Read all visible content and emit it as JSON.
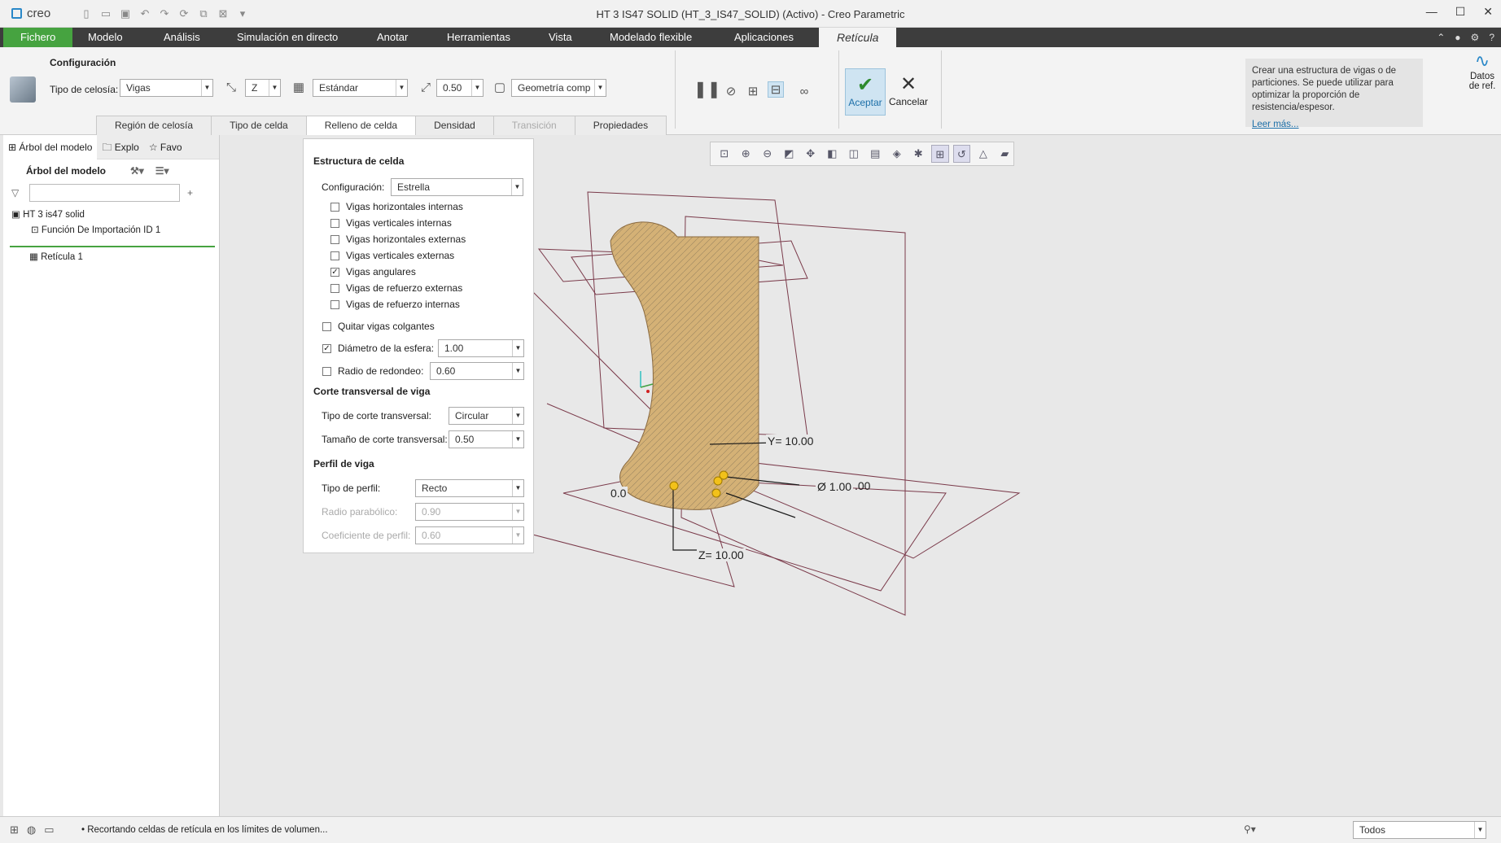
{
  "app": {
    "name": "creo",
    "window_title": "HT 3 IS47 SOLID (HT_3_IS47_SOLID) (Activo) - Creo Parametric"
  },
  "menu": {
    "file": "Fichero",
    "items": [
      "Modelo",
      "Análisis",
      "Simulación en directo",
      "Anotar",
      "Herramientas",
      "Vista",
      "Modelado flexible",
      "Aplicaciones"
    ],
    "active_tab": "Retícula"
  },
  "ribbon": {
    "group_label": "Configuración",
    "lattice_type_label": "Tipo de celosía:",
    "lattice_type_value": "Vigas",
    "axis_value": "Z",
    "pattern_value": "Estándar",
    "size_value": "0.50",
    "geometry_value": "Geometría comp",
    "accept": "Aceptar",
    "cancel": "Cancelar",
    "help_text": "Crear una estructura de vigas o de particiones. Se puede utilizar para optimizar la proporción de resistencia/espesor.",
    "help_link": "Leer más...",
    "ref_data": "Datos de ref."
  },
  "subtabs": [
    "Región de celosía",
    "Tipo de celda",
    "Relleno de celda",
    "Densidad",
    "Transición",
    "Propiedades"
  ],
  "sidebar": {
    "tabs": [
      "Árbol del modelo",
      "Explo",
      "Favo"
    ],
    "tree_title": "Árbol del modelo",
    "nodes": [
      "HT 3 is47 solid",
      "Función De Importación ID 1",
      "Retícula 1"
    ]
  },
  "panel": {
    "section1": "Estructura de celda",
    "config_label": "Configuración:",
    "config_value": "Estrella",
    "checkboxes": [
      {
        "label": "Vigas horizontales internas",
        "checked": false
      },
      {
        "label": "Vigas verticales internas",
        "checked": false
      },
      {
        "label": "Vigas horizontales externas",
        "checked": false
      },
      {
        "label": "Vigas verticales externas",
        "checked": false
      },
      {
        "label": "Vigas angulares",
        "checked": true
      },
      {
        "label": "Vigas de refuerzo externas",
        "checked": false
      },
      {
        "label": "Vigas de refuerzo internas",
        "checked": false
      }
    ],
    "remove_label": "Quitar vigas colgantes",
    "sphere_label": "Diámetro de la esfera:",
    "sphere_value": "1.00",
    "round_label": "Radio de redondeo:",
    "round_value": "0.60",
    "section2": "Corte transversal de viga",
    "cs_type_label": "Tipo de corte transversal:",
    "cs_type_value": "Circular",
    "cs_size_label": "Tamaño de corte transversal:",
    "cs_size_value": "0.50",
    "section3": "Perfil de viga",
    "profile_label": "Tipo de perfil:",
    "profile_value": "Recto",
    "parabolic_label": "Radio parabólico:",
    "parabolic_value": "0.90",
    "coef_label": "Coeficiente de perfil:",
    "coef_value": "0.60"
  },
  "dims": {
    "y": "Y= 10.00",
    "z": "Z= 10.00",
    "x": "0.0",
    "d": "Ø 1.00",
    "d2": ".00"
  },
  "status": {
    "message": "Recortando celdas de retícula en los límites de volumen...",
    "filter": "Todos"
  }
}
